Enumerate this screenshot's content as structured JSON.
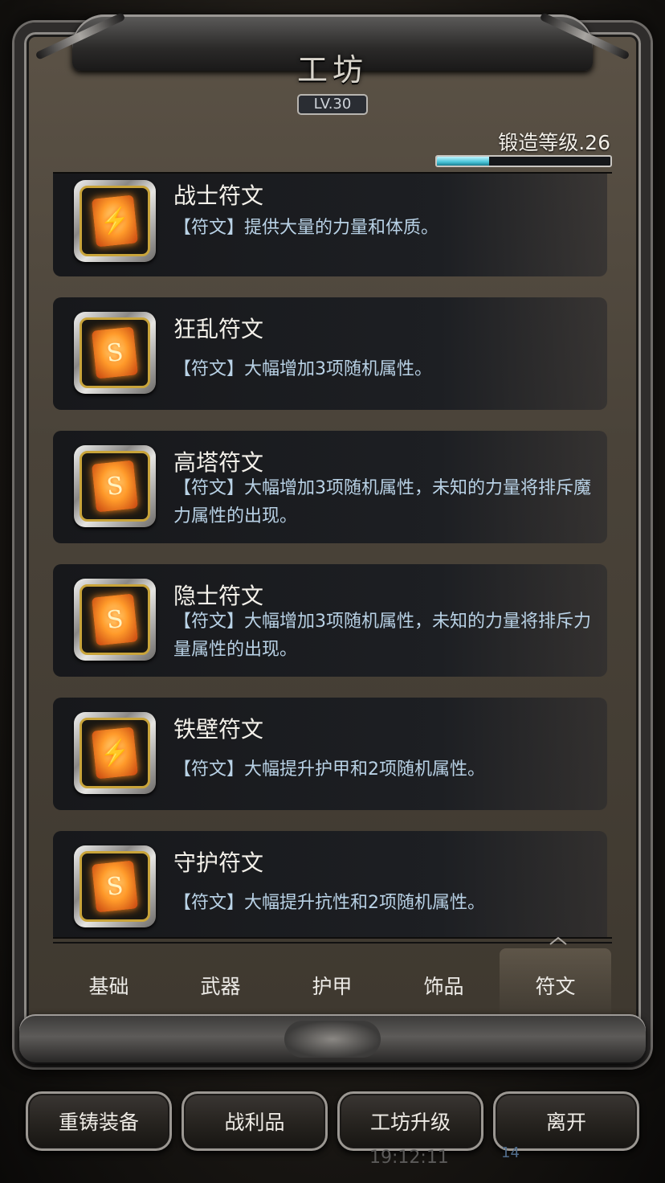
{
  "header": {
    "title": "工坊",
    "level": "LV.30"
  },
  "forge": {
    "label": "锻造等级.26",
    "progress_fraction": 0.3
  },
  "runes": [
    {
      "name": "战士符文",
      "desc": "【符文】提供大量的力量和体质。",
      "glyph": "⚡"
    },
    {
      "name": "狂乱符文",
      "desc": "【符文】大幅增加3项随机属性。",
      "glyph": "S"
    },
    {
      "name": "高塔符文",
      "desc": "【符文】大幅增加3项随机属性，未知的力量将排斥魔力属性的出现。",
      "glyph": "S"
    },
    {
      "name": "隐士符文",
      "desc": "【符文】大幅增加3项随机属性，未知的力量将排斥力量属性的出现。",
      "glyph": "S"
    },
    {
      "name": "铁壁符文",
      "desc": "【符文】大幅提升护甲和2项随机属性。",
      "glyph": "⚡"
    },
    {
      "name": "守护符文",
      "desc": "【符文】大幅提升抗性和2项随机属性。",
      "glyph": "S"
    }
  ],
  "tabs": [
    "基础",
    "武器",
    "护甲",
    "饰品",
    "符文"
  ],
  "active_tab": 4,
  "buttons": {
    "reforge": "重铸装备",
    "loot": "战利品",
    "upgrade": "工坊升级",
    "leave": "离开"
  },
  "status": {
    "time": "19:12:11",
    "count": "14"
  }
}
